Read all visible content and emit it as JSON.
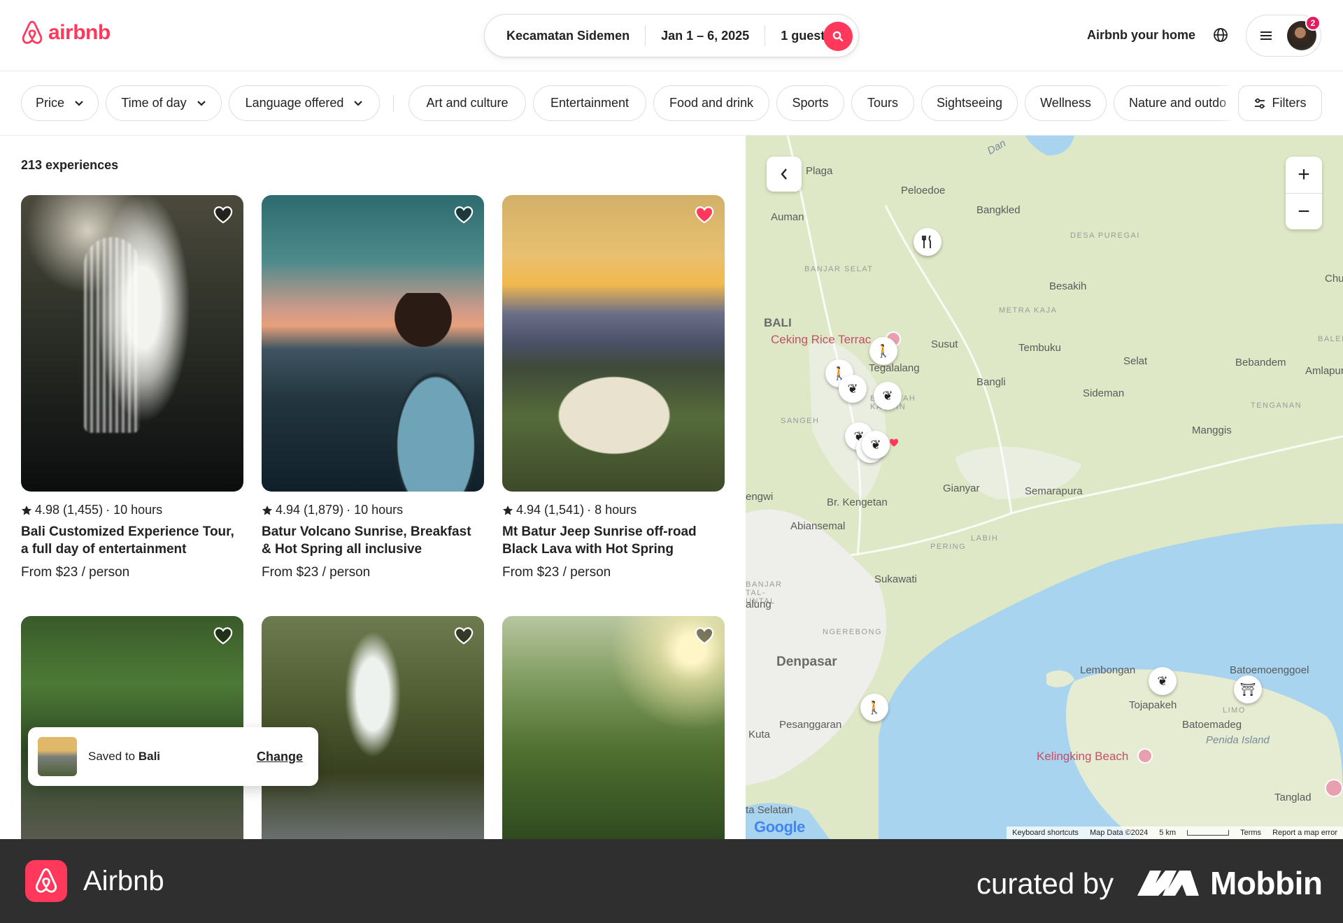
{
  "header": {
    "logo_text": "airbnb",
    "search": {
      "location": "Kecamatan Sidemen",
      "dates": "Jan 1 – 6, 2025",
      "guests": "1 guest"
    },
    "host_link": "Airbnb your home",
    "notification_count": "2"
  },
  "filters": {
    "dropdowns": [
      "Price",
      "Time of day",
      "Language offered"
    ],
    "categories": [
      "Art and culture",
      "Entertainment",
      "Food and drink",
      "Sports",
      "Tours",
      "Sightseeing",
      "Wellness",
      "Nature and outdo"
    ],
    "filters_button": "Filters"
  },
  "listings": {
    "count_label": "213 experiences",
    "cards": [
      {
        "rating": "4.98 (1,455)",
        "duration": "· 10 hours",
        "title": "Bali Customized Experience Tour, a full day of entertainment",
        "price": "From $23 / person",
        "saved": false
      },
      {
        "rating": "4.94 (1,879)",
        "duration": "· 10 hours",
        "title": "Batur Volcano Sunrise, Breakfast & Hot Spring all inclusive",
        "price": "From $23 / person",
        "saved": false
      },
      {
        "rating": "4.94 (1,541)",
        "duration": "· 8 hours",
        "title": "Mt Batur Jeep Sunrise off-road Black Lava with Hot Spring",
        "price": "From $23 / person",
        "saved": true
      },
      {
        "saved": false
      },
      {
        "saved": false
      },
      {
        "saved": false
      }
    ]
  },
  "toast": {
    "prefix": "Saved to",
    "wishlist": "Bali",
    "action": "Change"
  },
  "map": {
    "labels": {
      "plaga": "Plaga",
      "peloedoe": "Peloedoe",
      "bangkled": "Bangkled",
      "auman": "Auman",
      "desa_puregai": "DESA PUREGAI",
      "banjar_selat": "BANJAR SELAT",
      "besakih": "Besakih",
      "chu": "Chu",
      "metra_kaja": "METRA KAJA",
      "bali": "BALI",
      "ceking": "Ceking Rice Terrac",
      "balep": "BALEP",
      "susut": "Susut",
      "tembuku": "Tembuku",
      "tegalalang": "Tegalalang",
      "selat": "Selat",
      "bebandem": "Bebandem",
      "amlapura": "Amlapura",
      "bangli": "Bangli",
      "benawah": "BENAWAH KANGIN",
      "sideman": "Sideman",
      "tenganan": "TENGANAN",
      "sangeh": "SANGEH",
      "manggis": "Manggis",
      "gianyar": "Gianyar",
      "semarapura": "Semarapura",
      "engwi": "engwi",
      "kengetan": "Br. Kengetan",
      "abiansemal": "Abiansemal",
      "labih": "LABIH",
      "pering": "PERING",
      "sukawati": "Sukawati",
      "banjar_tal": "BANJAR TAL-UNTAL",
      "alung": "alung",
      "ngerebong": "NGEREBONG",
      "denpasar": "Denpasar",
      "lembongan": "Lembongan",
      "batoemoenggoel": "Batoemoenggoel",
      "tojapakeh": "Tojapakeh",
      "limo": "LIMO",
      "batoemadeg": "Batoemadeg",
      "penida": "Penida Island",
      "pesanggaran": "Pesanggaran",
      "kuta": "Kuta",
      "kelingking": "Kelingking Beach",
      "tanglad": "Tanglad",
      "ta_selatan": "ta Selatan",
      "dan": "Dan"
    },
    "zoom_in": "+",
    "zoom_out": "−",
    "google": "Google",
    "attribution": [
      "Keyboard shortcuts",
      "Map Data ©2024",
      "5 km",
      "Terms",
      "Report a map error"
    ]
  },
  "bottom_bar": {
    "app_name": "Airbnb",
    "curated_by": "curated by",
    "brand": "Mobbin"
  },
  "colors": {
    "brand": "#ff385c",
    "saved_heart": "#ff385c",
    "notification": "#e31c5f",
    "sea": "#a8d4f0",
    "land": "#dfe8c6"
  }
}
